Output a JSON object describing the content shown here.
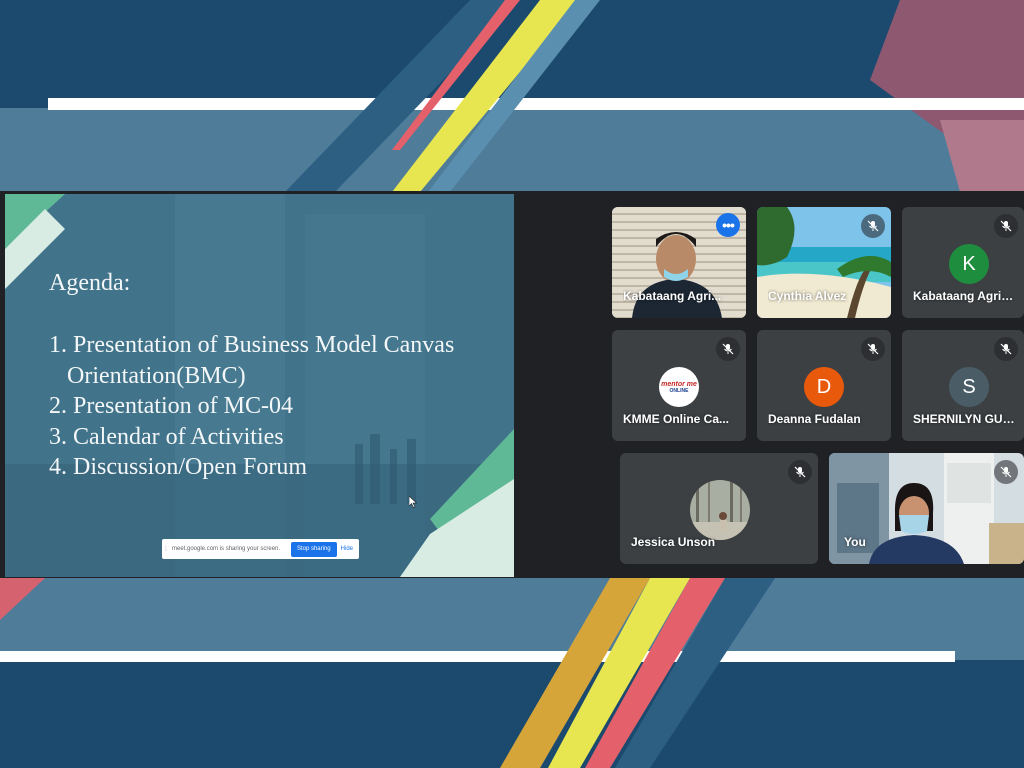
{
  "colors": {
    "accent_blue": "#1a73e8",
    "speaking_border": "#8ab4f8",
    "tile_bg": "#3c4043",
    "meet_bg": "#202124",
    "avatar_k": "#1e8e3e",
    "avatar_d": "#e8590c",
    "avatar_s": "#4a5d66"
  },
  "slide": {
    "title": "Agenda:",
    "items": [
      {
        "num": "1.",
        "line1": "Presentation of Business Model Canvas",
        "line2": "Orientation(BMC)"
      },
      {
        "num": "2.",
        "line1": "Presentation of MC-04"
      },
      {
        "num": "3.",
        "line1": "Calendar of Activities"
      },
      {
        "num": "4.",
        "line1": "Discussion/Open Forum"
      }
    ]
  },
  "share_bar": {
    "message": "meet.google.com is sharing your screen.",
    "stop_label": "Stop sharing",
    "hide_label": "Hide"
  },
  "participants": [
    {
      "name": "Kabataang Agri...",
      "type": "video-person",
      "speaking": true,
      "icon": "more-options-icon"
    },
    {
      "name": "Cynthia Alvez",
      "type": "video-beach",
      "muted": true
    },
    {
      "name": "Kabataang Agribi...",
      "type": "avatar",
      "initial": "K",
      "muted": true
    },
    {
      "name": "KMME Online Ca...",
      "type": "logo",
      "logo_text": "mentor me",
      "logo_sub": "ONLINE",
      "muted": true
    },
    {
      "name": "Deanna Fudalan",
      "type": "avatar",
      "initial": "D",
      "muted": true
    },
    {
      "name": "SHERNILYN GUZ...",
      "type": "avatar",
      "initial": "S",
      "muted": true
    },
    {
      "name": "Jessica Unson",
      "type": "photo",
      "muted": true
    },
    {
      "name": "You",
      "type": "video-self",
      "muted": true
    }
  ]
}
